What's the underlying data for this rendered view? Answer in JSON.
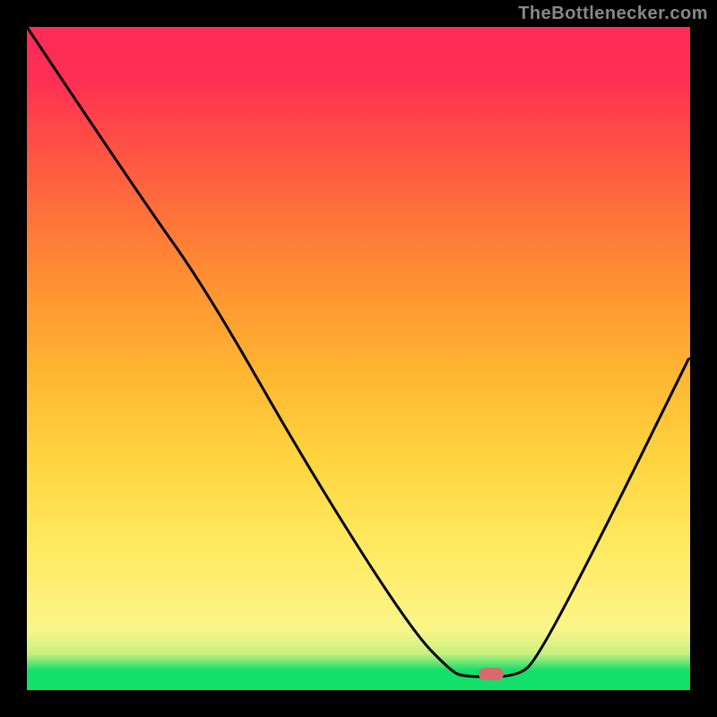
{
  "watermark": {
    "text": "TheBottlenecker.com"
  },
  "marker": {
    "x_screen_frac": 0.7,
    "y_screen_frac": 0.975,
    "color": "#d66a6f"
  },
  "curve": {
    "comment": "x in [0,1] is horizontal fraction left→right across plot; y in [0,1] is vertical fraction top→bottom. These are screen-space control points for the black V-curve.",
    "points": [
      {
        "x": 0.0,
        "y": 0.0
      },
      {
        "x": 0.17,
        "y": 0.255
      },
      {
        "x": 0.27,
        "y": 0.395
      },
      {
        "x": 0.43,
        "y": 0.675
      },
      {
        "x": 0.58,
        "y": 0.91
      },
      {
        "x": 0.64,
        "y": 0.972
      },
      {
        "x": 0.66,
        "y": 0.98
      },
      {
        "x": 0.74,
        "y": 0.98
      },
      {
        "x": 0.77,
        "y": 0.952
      },
      {
        "x": 0.87,
        "y": 0.76
      },
      {
        "x": 0.998,
        "y": 0.5
      }
    ],
    "stroke": "#000000",
    "stroke_width": 3
  },
  "gradient_stops": [
    {
      "pos": 0.0,
      "color": "#13e06a"
    },
    {
      "pos": 0.03,
      "color": "#13e06a"
    },
    {
      "pos": 0.055,
      "color": "#c8f080"
    },
    {
      "pos": 0.09,
      "color": "#f8f58a"
    },
    {
      "pos": 0.14,
      "color": "#fff07a"
    },
    {
      "pos": 0.22,
      "color": "#ffe95e"
    },
    {
      "pos": 0.35,
      "color": "#ffd43f"
    },
    {
      "pos": 0.48,
      "color": "#ffb531"
    },
    {
      "pos": 0.62,
      "color": "#ff8f33"
    },
    {
      "pos": 0.74,
      "color": "#ff6a3c"
    },
    {
      "pos": 0.84,
      "color": "#ff4a47"
    },
    {
      "pos": 0.92,
      "color": "#ff2f53"
    },
    {
      "pos": 1.0,
      "color": "#fd2a57"
    }
  ],
  "chart_data": {
    "type": "line",
    "title": "",
    "xlabel": "",
    "ylabel": "",
    "xlim": [
      0,
      100
    ],
    "ylim": [
      0,
      100
    ],
    "comment": "Bottleneck-percentage vs. relative-component-performance curve. x is left→right position (percent of axis); y is bottleneck percentage (0 = no bottleneck at green floor, 100 = full bottleneck at red top). Values read visually from the gradient/curve — no axis ticks present.",
    "x": [
      0,
      17,
      27,
      43,
      58,
      64,
      66,
      74,
      77,
      87,
      100
    ],
    "values": [
      100,
      74,
      60,
      32,
      9,
      3,
      2,
      2,
      5,
      24,
      50
    ],
    "optimum_marker": {
      "x": 70,
      "y": 2
    },
    "background": "vertical red→green gradient encoding bottleneck severity"
  }
}
